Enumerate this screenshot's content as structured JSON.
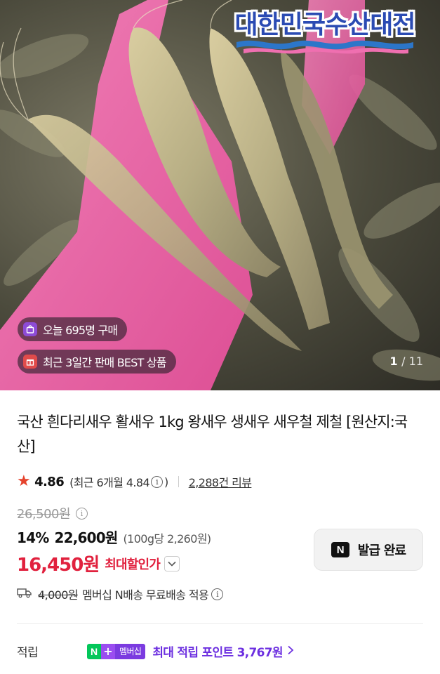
{
  "hero": {
    "logo_text": "대한민국수산대전",
    "badges": [
      {
        "icon": "shopping-bag-icon",
        "text": "오늘 695명 구매"
      },
      {
        "icon": "gift-icon",
        "text": "최근 3일간 판매 BEST 상품"
      }
    ],
    "pager": {
      "current": "1",
      "total": "/ 11"
    }
  },
  "product": {
    "title": "국산 흰다리새우 활새우 1kg 왕새우 생새우 새우철 제철 [원산지:국산]",
    "rating": "4.86",
    "rating_recent": "(최근 6개월 4.84",
    "rating_close": ")",
    "reviews": "2,288건 리뷰",
    "original_price": "26,500원",
    "discount": "14%",
    "sale_price": "22,600원",
    "unit_price": "(100g당 2,260원)",
    "max_price": "16,450원",
    "max_label": "최대할인가",
    "coupon_button": "발급 완료",
    "shipping_original": "4,000원",
    "shipping_text": "멤버십 N배송 무료배송 적용",
    "points_label": "적립",
    "membership_badge": {
      "n": "N",
      "plus": "+",
      "text": "멤버십"
    },
    "points_text": "최대 적립 포인트 3,767원"
  },
  "colors": {
    "sale_red": "#e1213e",
    "star": "#e5432d",
    "points_purple": "#6c2fe0",
    "naver_green": "#03c75a"
  }
}
